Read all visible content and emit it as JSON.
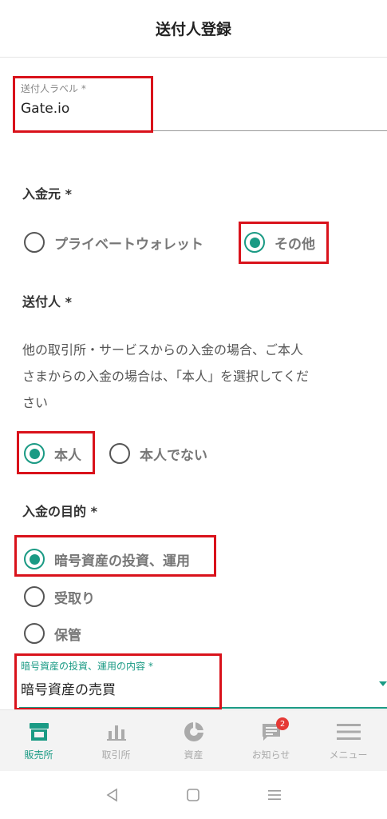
{
  "header": {
    "title": "送付人登録"
  },
  "sender_label": {
    "label": "送付人ラベル *",
    "value": "Gate.io"
  },
  "deposit_source": {
    "title": "入金元 *",
    "options": [
      {
        "label": "プライベートウォレット",
        "selected": false
      },
      {
        "label": "その他",
        "selected": true
      }
    ]
  },
  "sender": {
    "title": "送付人 *",
    "description_lines": [
      "他の取引所・サービスからの入金の場合、ご本人",
      "さまからの入金の場合は、「本人」を選択してくだ",
      "さい"
    ],
    "options": [
      {
        "label": "本人",
        "selected": true
      },
      {
        "label": "本人でない",
        "selected": false
      }
    ]
  },
  "purpose": {
    "title": "入金の目的 *",
    "options": [
      {
        "label": "暗号資産の投資、運用",
        "selected": true
      },
      {
        "label": "受取り",
        "selected": false
      },
      {
        "label": "保管",
        "selected": false
      }
    ]
  },
  "detail": {
    "label": "暗号資産の投資、運用の内容 *",
    "value": "暗号資産の売買"
  },
  "tabs": [
    {
      "label": "販売所",
      "icon": "store-icon",
      "active": true
    },
    {
      "label": "取引所",
      "icon": "bar-chart-icon",
      "active": false
    },
    {
      "label": "資産",
      "icon": "pie-chart-icon",
      "active": false
    },
    {
      "label": "お知らせ",
      "icon": "message-icon",
      "active": false,
      "badge": "2"
    },
    {
      "label": "メニュー",
      "icon": "menu-icon",
      "active": false
    }
  ],
  "colors": {
    "accent": "#1a9a84",
    "highlight": "#d9121b",
    "badge": "#e53935"
  }
}
